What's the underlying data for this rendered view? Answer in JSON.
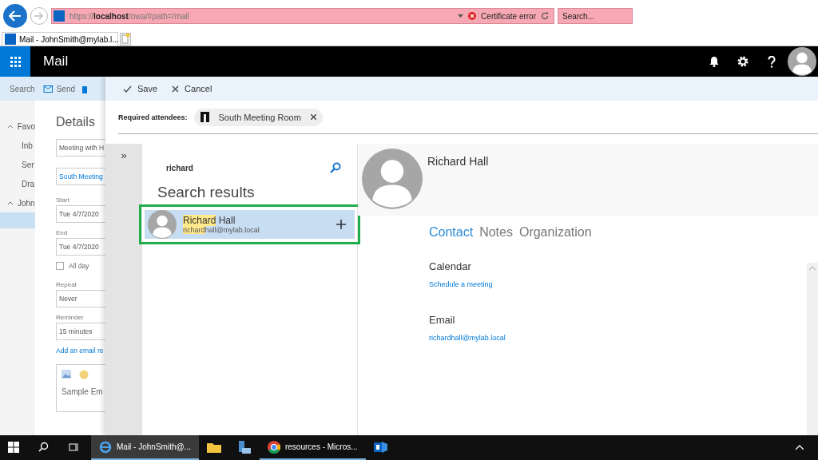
{
  "browser": {
    "address": "https://**localhost**/owa/#path=/mail",
    "certificate": "Certificate error",
    "search_placeholder": "Search..."
  },
  "tabs": [
    {
      "label": "Mail - JohnSmith@mylab.l...",
      "selected": true
    }
  ],
  "app_bar": {
    "title": "Mail"
  },
  "background": {
    "toolbar": [
      "Search",
      "Send"
    ],
    "nav": [
      {
        "label": "Favo",
        "expanded": true,
        "children": [
          {
            "label": "Inb"
          },
          {
            "label": "Ser"
          },
          {
            "label": "Dra"
          }
        ]
      },
      {
        "label": "John",
        "expanded": true
      }
    ],
    "details": {
      "title": "Details",
      "fields": [
        {
          "kind": "input",
          "value": "Meeting with H"
        },
        {
          "kind": "location",
          "value": "South Meeting"
        },
        {
          "kind": "labeled",
          "label": "Start",
          "value": "Tue 4/7/2020"
        },
        {
          "kind": "labeled",
          "label": "End",
          "value": "Tue 4/7/2020"
        },
        {
          "kind": "checkbox",
          "label": "All day",
          "checked": false
        },
        {
          "kind": "labeled",
          "label": "Repeat",
          "value": "Never"
        },
        {
          "kind": "labeled",
          "label": "Reminder",
          "value": "15 minutes"
        },
        {
          "kind": "link",
          "label": "Add an email re"
        },
        {
          "kind": "editor",
          "value": "Sample Em"
        }
      ]
    }
  },
  "panel": {
    "toolbar": [
      {
        "kind": "save",
        "label": "Save"
      },
      {
        "kind": "cancel",
        "label": "Cancel"
      }
    ],
    "attendees": {
      "label": "Required attendees:",
      "chips": [
        {
          "label": "South Meeting Room"
        }
      ]
    },
    "expand": "»",
    "search": {
      "value": "richard",
      "results_title": "Search results",
      "results": [
        {
          "name_match": "Richard",
          "name_rest": "Hall",
          "email_match": "richard",
          "email_rest": "hall@mylab.local",
          "selected": true,
          "outlined": true
        }
      ]
    },
    "contact": {
      "name": "Richard Hall",
      "tabs": [
        {
          "label": "Contact",
          "selected": true
        },
        {
          "label": "Notes",
          "selected": false
        },
        {
          "label": "Organization",
          "selected": false
        }
      ],
      "sections": [
        {
          "title": "Calendar",
          "link": "Schedule a meeting"
        },
        {
          "title": "Email",
          "link": "richardhall@mylab.local"
        }
      ]
    }
  },
  "taskbar": {
    "apps": [
      {
        "kind": "ie",
        "label": "Mail - JohnSmith@...",
        "selected": true
      },
      {
        "kind": "folder",
        "selected": false
      },
      {
        "kind": "server",
        "selected": false
      },
      {
        "kind": "chrome",
        "label": "resources - Micros...",
        "selected": false
      },
      {
        "kind": "exchange",
        "selected": false
      }
    ]
  }
}
